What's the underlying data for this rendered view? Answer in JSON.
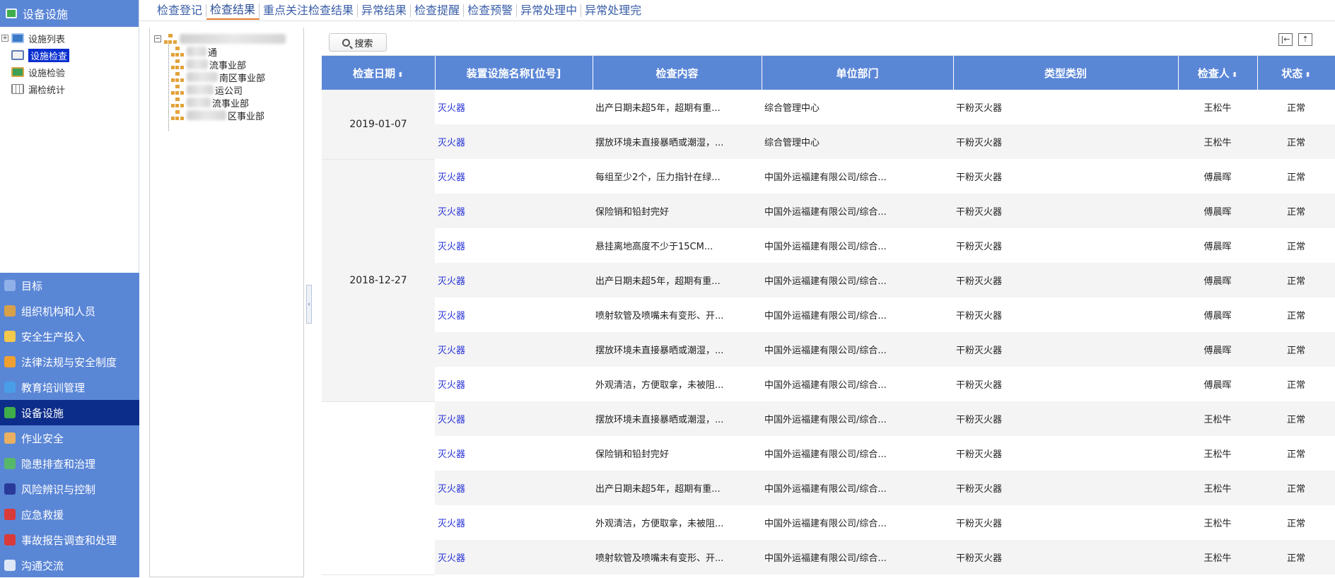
{
  "sidebar": {
    "header_title": "设备设施",
    "tree": [
      {
        "label": "设施列表",
        "icon": "monitor-icon",
        "expandable": true,
        "selected": false
      },
      {
        "label": "设施检查",
        "icon": "checklist-icon",
        "expandable": false,
        "selected": true
      },
      {
        "label": "设施检验",
        "icon": "chart-icon",
        "expandable": false,
        "selected": false
      },
      {
        "label": "漏检统计",
        "icon": "grid-icon",
        "expandable": false,
        "selected": false
      }
    ],
    "menu": [
      {
        "label": "目标",
        "icon": "monitor-icon",
        "color": "#8fb0e8"
      },
      {
        "label": "组织机构和人员",
        "icon": "people-icon",
        "color": "#d9a04a"
      },
      {
        "label": "安全生产投入",
        "icon": "money-icon",
        "color": "#f2c94c"
      },
      {
        "label": "法律法规与安全制度",
        "icon": "book-icon",
        "color": "#f0a030"
      },
      {
        "label": "教育培训管理",
        "icon": "training-icon",
        "color": "#4a9ee8"
      },
      {
        "label": "设备设施",
        "icon": "equipment-icon",
        "color": "#3fae4a",
        "active": true
      },
      {
        "label": "作业安全",
        "icon": "worker-icon",
        "color": "#e8b060"
      },
      {
        "label": "隐患排查和治理",
        "icon": "inspect-icon",
        "color": "#57b86a"
      },
      {
        "label": "风险辨识与控制",
        "icon": "warning-icon",
        "color": "#2a3a9a"
      },
      {
        "label": "应急救援",
        "icon": "rescue-icon",
        "color": "#d93a3a"
      },
      {
        "label": "事故报告调查和处理",
        "icon": "alarm-icon",
        "color": "#d93a3a"
      },
      {
        "label": "沟通交流",
        "icon": "user-icon",
        "color": "#dfe8f7"
      }
    ]
  },
  "tabs": [
    {
      "label": "检查登记",
      "active": false
    },
    {
      "label": "检查结果",
      "active": true
    },
    {
      "label": "重点关注检查结果",
      "active": false
    },
    {
      "label": "异常结果",
      "active": false
    },
    {
      "label": "检查提醒",
      "active": false
    },
    {
      "label": "检查预警",
      "active": false
    },
    {
      "label": "异常处理中",
      "active": false
    },
    {
      "label": "异常处理完",
      "active": false
    }
  ],
  "org_tree": {
    "children": [
      {
        "label": "通"
      },
      {
        "label": "流事业部"
      },
      {
        "label": "南区事业部"
      },
      {
        "label": "运公司"
      },
      {
        "label": "流事业部"
      },
      {
        "label": "区事业部"
      }
    ]
  },
  "toolbar": {
    "search_label": "搜索"
  },
  "table": {
    "columns": [
      {
        "label": "检查日期",
        "sortable": true
      },
      {
        "label": "装置设施名称[位号]",
        "sortable": false
      },
      {
        "label": "检查内容",
        "sortable": false
      },
      {
        "label": "单位部门",
        "sortable": false
      },
      {
        "label": "类型类别",
        "sortable": false
      },
      {
        "label": "检查人",
        "sortable": true
      },
      {
        "label": "状态",
        "sortable": true
      }
    ],
    "groups": [
      {
        "date": "2019-01-07",
        "rows": [
          {
            "name": "灭火器",
            "content": "出产日期未超5年，超期有重...",
            "dept": "综合管理中心",
            "type": "干粉灭火器",
            "inspector": "王松牛",
            "status": "正常"
          },
          {
            "name": "灭火器",
            "content": "摆放环境未直接暴晒或潮湿，...",
            "dept": "综合管理中心",
            "type": "干粉灭火器",
            "inspector": "王松牛",
            "status": "正常"
          }
        ]
      },
      {
        "date": "2018-12-27",
        "rows": [
          {
            "name": "灭火器",
            "content": "每组至少2个，压力指针在绿...",
            "dept": "中国外运福建有限公司/综合...",
            "type": "干粉灭火器",
            "inspector": "傅晨晖",
            "status": "正常"
          },
          {
            "name": "灭火器",
            "content": "保险销和铅封完好",
            "dept": "中国外运福建有限公司/综合...",
            "type": "干粉灭火器",
            "inspector": "傅晨晖",
            "status": "正常"
          },
          {
            "name": "灭火器",
            "content": "悬挂离地高度不少于15CM...",
            "dept": "中国外运福建有限公司/综合...",
            "type": "干粉灭火器",
            "inspector": "傅晨晖",
            "status": "正常"
          },
          {
            "name": "灭火器",
            "content": "出产日期未超5年，超期有重...",
            "dept": "中国外运福建有限公司/综合...",
            "type": "干粉灭火器",
            "inspector": "傅晨晖",
            "status": "正常"
          },
          {
            "name": "灭火器",
            "content": "喷射软管及喷嘴未有变形、开...",
            "dept": "中国外运福建有限公司/综合...",
            "type": "干粉灭火器",
            "inspector": "傅晨晖",
            "status": "正常"
          },
          {
            "name": "灭火器",
            "content": "摆放环境未直接暴晒或潮湿，...",
            "dept": "中国外运福建有限公司/综合...",
            "type": "干粉灭火器",
            "inspector": "傅晨晖",
            "status": "正常"
          },
          {
            "name": "灭火器",
            "content": "外观清洁，方便取拿，未被阻...",
            "dept": "中国外运福建有限公司/综合...",
            "type": "干粉灭火器",
            "inspector": "傅晨晖",
            "status": "正常"
          }
        ]
      },
      {
        "date": "",
        "rows": [
          {
            "name": "灭火器",
            "content": "摆放环境未直接暴晒或潮湿，...",
            "dept": "中国外运福建有限公司/综合...",
            "type": "干粉灭火器",
            "inspector": "王松牛",
            "status": "正常"
          },
          {
            "name": "灭火器",
            "content": "保险销和铅封完好",
            "dept": "中国外运福建有限公司/综合...",
            "type": "干粉灭火器",
            "inspector": "王松牛",
            "status": "正常"
          },
          {
            "name": "灭火器",
            "content": "出产日期未超5年，超期有重...",
            "dept": "中国外运福建有限公司/综合...",
            "type": "干粉灭火器",
            "inspector": "王松牛",
            "status": "正常"
          },
          {
            "name": "灭火器",
            "content": "外观清洁，方便取拿，未被阻...",
            "dept": "中国外运福建有限公司/综合...",
            "type": "干粉灭火器",
            "inspector": "王松牛",
            "status": "正常"
          },
          {
            "name": "灭火器",
            "content": "喷射软管及喷嘴未有变形、开...",
            "dept": "中国外运福建有限公司/综合...",
            "type": "干粉灭火器",
            "inspector": "王松牛",
            "status": "正常"
          }
        ]
      }
    ]
  }
}
